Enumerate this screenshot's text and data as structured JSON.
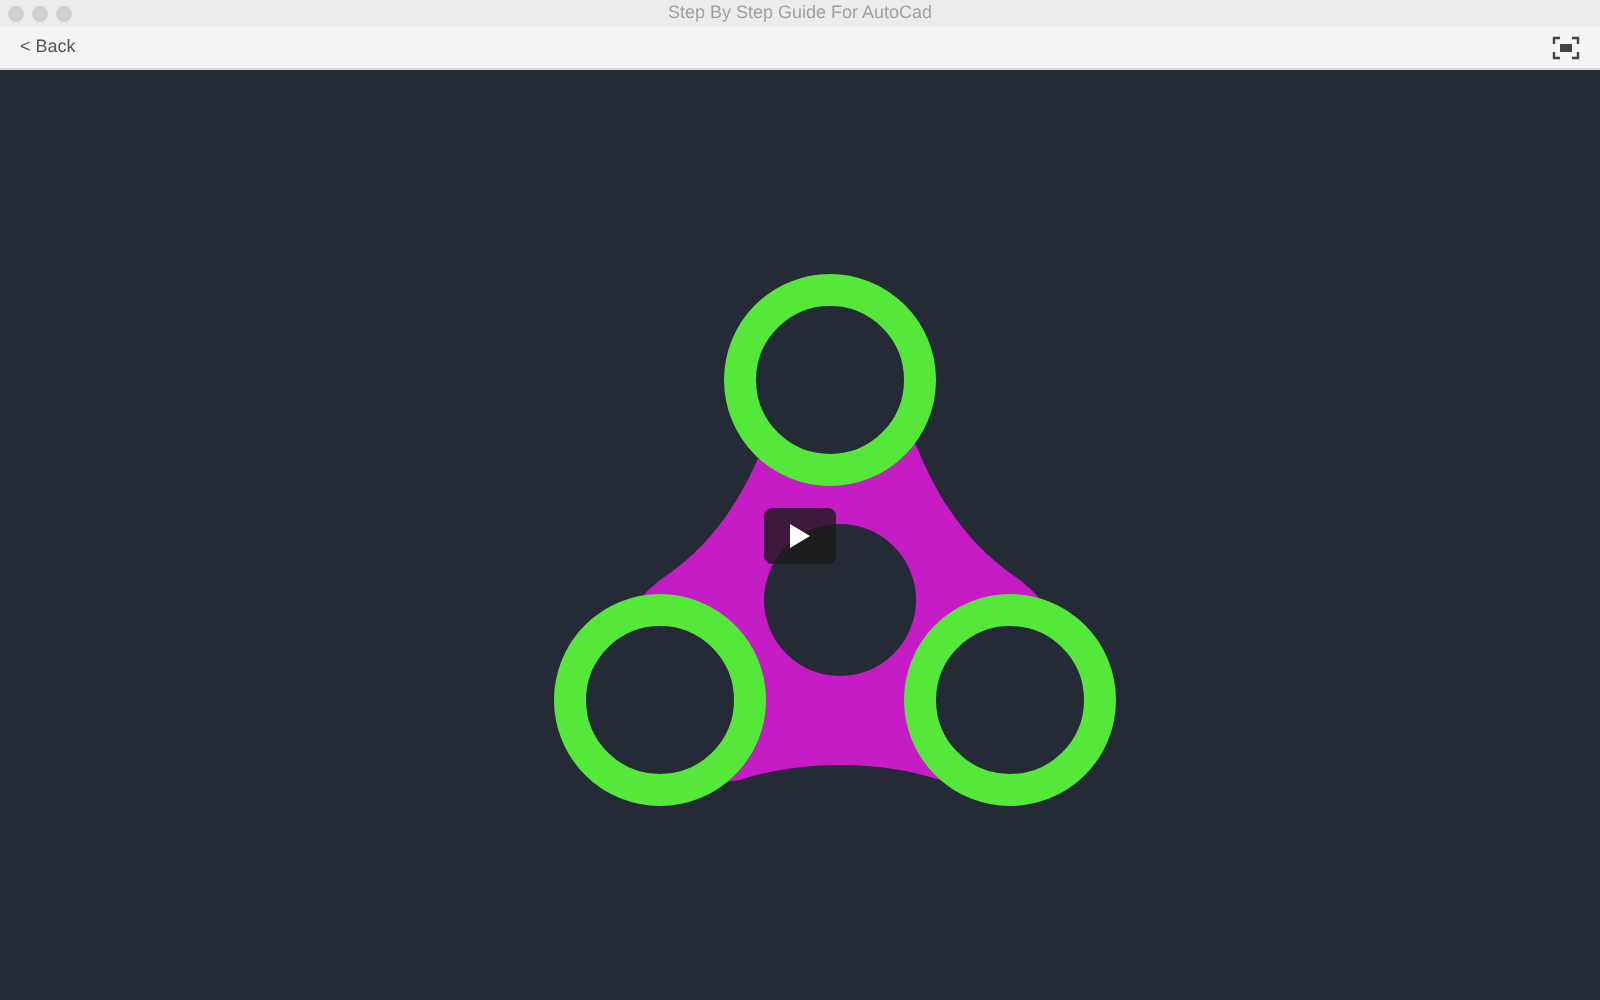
{
  "window": {
    "title": "Step By Step Guide For AutoCad"
  },
  "nav": {
    "back": "< Back"
  },
  "video": {
    "playing": false
  }
}
